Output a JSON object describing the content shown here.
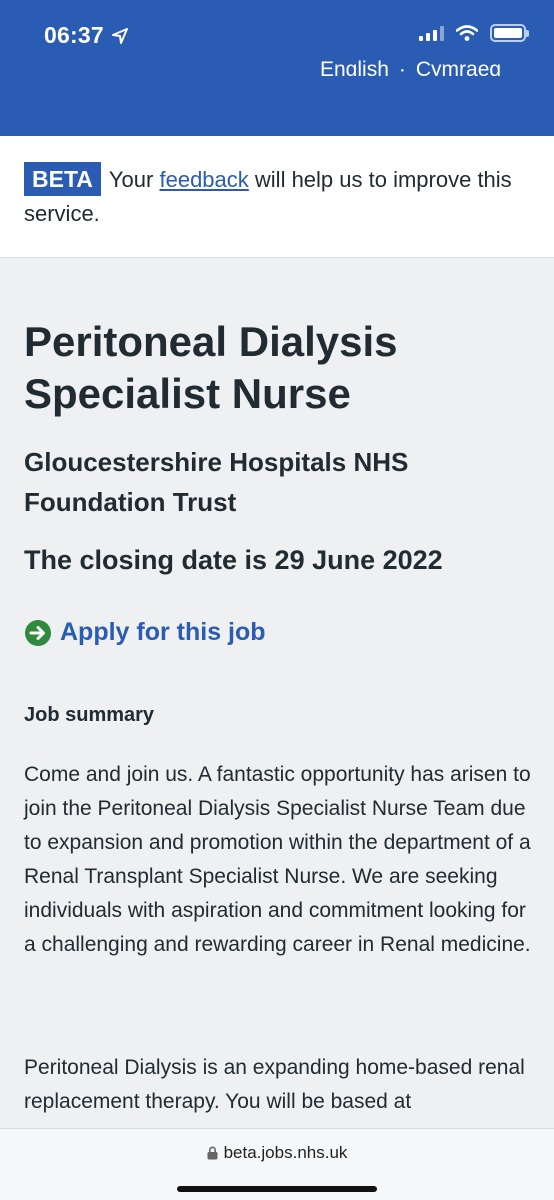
{
  "status_bar": {
    "time": "06:37"
  },
  "header": {
    "lang_english": "English",
    "lang_separator": "·",
    "lang_welsh": "Cymraeg"
  },
  "beta_banner": {
    "tag": "BETA",
    "text_before": "Your",
    "link": "feedback",
    "text_after": "will help us to improve this service."
  },
  "job": {
    "title": "Peritoneal Dialysis Specialist Nurse",
    "employer": "Gloucestershire Hospitals NHS Foundation Trust",
    "closing_date": "The closing date is 29 June 2022",
    "apply_label": "Apply for this job",
    "summary_heading": "Job summary",
    "summary_p1": "Come and join us. A fantastic opportunity has arisen to join the Peritoneal Dialysis Specialist Nurse Team due to expansion and promotion within the department of a Renal Transplant Specialist Nurse. We are seeking individuals with aspiration and commitment looking for a challenging and rewarding career in Renal medicine.",
    "summary_p2": "Peritoneal Dialysis is an expanding home-based renal replacement therapy. You will be based at"
  },
  "browser": {
    "url": "beta.jobs.nhs.uk"
  },
  "colors": {
    "nhs_blue": "#2a5cb3",
    "apply_green": "#2f8a3e",
    "text": "#212b32",
    "background": "#eef0f2"
  },
  "icons": [
    "location-arrow-icon",
    "signal-icon",
    "wifi-icon",
    "battery-icon",
    "arrow-right-circle-icon",
    "lock-icon"
  ]
}
